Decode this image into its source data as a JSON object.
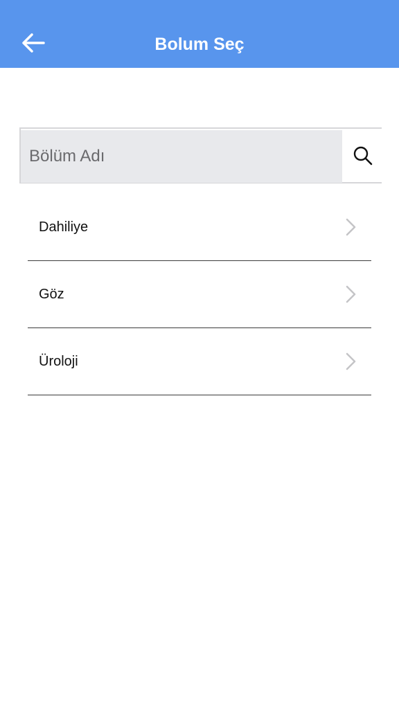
{
  "header": {
    "title": "Bolum Seç",
    "back_icon": "arrow-left-icon",
    "background_color": "#5895ed"
  },
  "search": {
    "placeholder": "Bölüm Adı",
    "value": "",
    "icon": "search-icon"
  },
  "departments": [
    {
      "label": "Dahiliye",
      "icon": "chevron-right-icon"
    },
    {
      "label": "Göz",
      "icon": "chevron-right-icon"
    },
    {
      "label": "Üroloji",
      "icon": "chevron-right-icon"
    }
  ]
}
